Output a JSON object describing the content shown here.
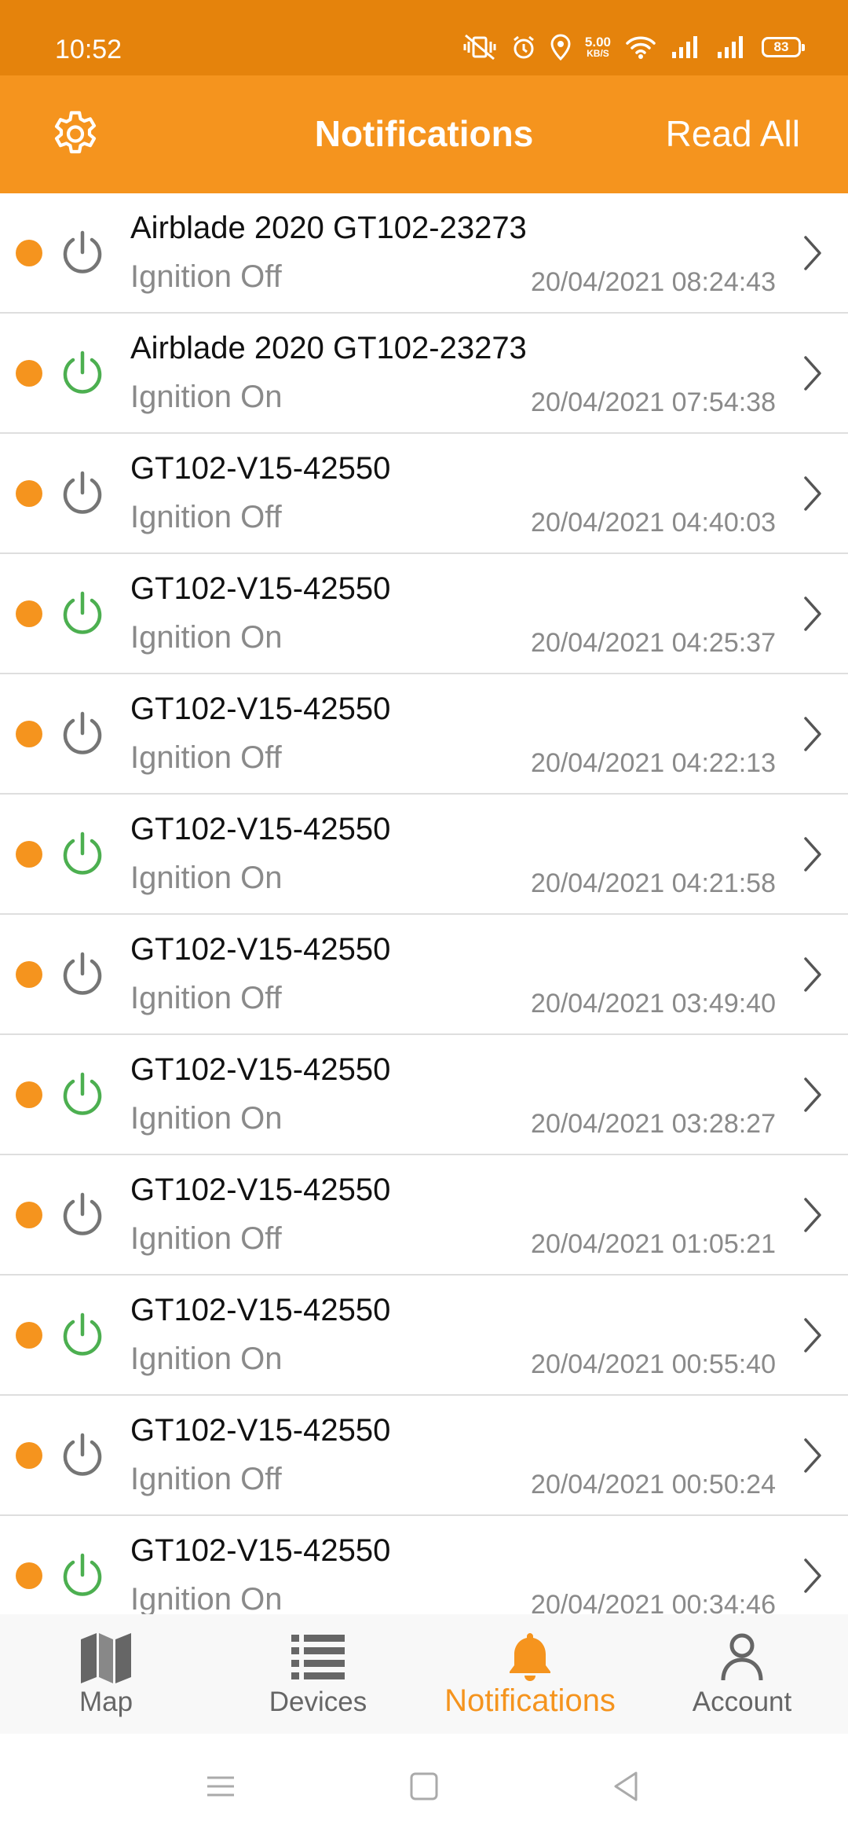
{
  "status_bar": {
    "time": "10:52",
    "net_speed_value": "5.00",
    "net_speed_unit": "KB/S",
    "battery": "83"
  },
  "header": {
    "title": "Notifications",
    "read_all": "Read All"
  },
  "colors": {
    "accent": "#f5941e",
    "status_bar": "#e5830c",
    "ignition_on": "#4caf50",
    "ignition_off": "#757575"
  },
  "notifications": [
    {
      "device": "Airblade 2020 GT102-23273",
      "event": "Ignition Off",
      "time": "20/04/2021 08:24:43",
      "state": "off"
    },
    {
      "device": "Airblade 2020 GT102-23273",
      "event": "Ignition On",
      "time": "20/04/2021 07:54:38",
      "state": "on"
    },
    {
      "device": "GT102-V15-42550",
      "event": "Ignition Off",
      "time": "20/04/2021 04:40:03",
      "state": "off"
    },
    {
      "device": "GT102-V15-42550",
      "event": "Ignition On",
      "time": "20/04/2021 04:25:37",
      "state": "on"
    },
    {
      "device": "GT102-V15-42550",
      "event": "Ignition Off",
      "time": "20/04/2021 04:22:13",
      "state": "off"
    },
    {
      "device": "GT102-V15-42550",
      "event": "Ignition On",
      "time": "20/04/2021 04:21:58",
      "state": "on"
    },
    {
      "device": "GT102-V15-42550",
      "event": "Ignition Off",
      "time": "20/04/2021 03:49:40",
      "state": "off"
    },
    {
      "device": "GT102-V15-42550",
      "event": "Ignition On",
      "time": "20/04/2021 03:28:27",
      "state": "on"
    },
    {
      "device": "GT102-V15-42550",
      "event": "Ignition Off",
      "time": "20/04/2021 01:05:21",
      "state": "off"
    },
    {
      "device": "GT102-V15-42550",
      "event": "Ignition On",
      "time": "20/04/2021 00:55:40",
      "state": "on"
    },
    {
      "device": "GT102-V15-42550",
      "event": "Ignition Off",
      "time": "20/04/2021 00:50:24",
      "state": "off"
    },
    {
      "device": "GT102-V15-42550",
      "event": "Ignition On",
      "time": "20/04/2021 00:34:46",
      "state": "on"
    }
  ],
  "bottom_nav": [
    {
      "label": "Map",
      "icon": "map-icon",
      "active": false
    },
    {
      "label": "Devices",
      "icon": "list-icon",
      "active": false
    },
    {
      "label": "Notifications",
      "icon": "bell-icon",
      "active": true
    },
    {
      "label": "Account",
      "icon": "person-icon",
      "active": false
    }
  ],
  "system_nav": [
    "menu-icon",
    "home-icon",
    "back-icon"
  ]
}
